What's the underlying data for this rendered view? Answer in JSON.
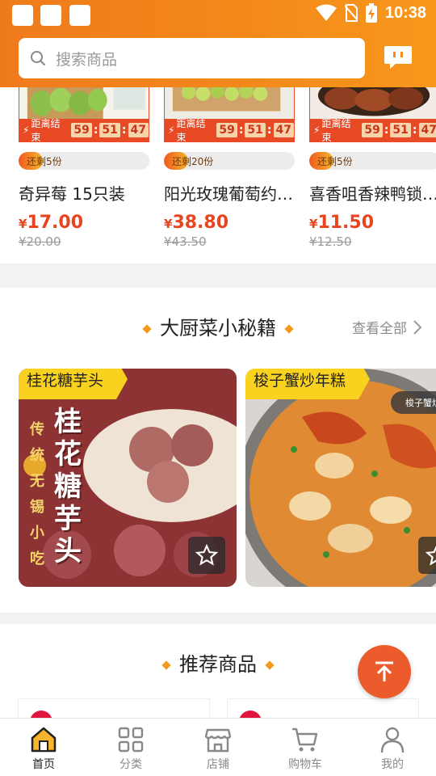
{
  "status": {
    "time": "10:38"
  },
  "search": {
    "placeholder": "搜索商品"
  },
  "flash_sale": {
    "countdown_label": "距离结束",
    "hours": "59",
    "minutes": "51",
    "seconds": "47",
    "items": [
      {
        "stock": "还剩5份",
        "name": "奇异莓 15只装",
        "currency": "¥",
        "price": "17.00",
        "old_price": "¥20.00"
      },
      {
        "stock": "还剩20份",
        "name": "阳光玫瑰葡萄约…",
        "currency": "¥",
        "price": "38.80",
        "old_price": "¥43.50"
      },
      {
        "stock": "还剩5份",
        "name": "喜香咀香辣鸭锁…",
        "currency": "¥",
        "price": "11.50",
        "old_price": "¥12.50"
      }
    ]
  },
  "recipes": {
    "title": "大厨菜小秘籍",
    "see_all": "查看全部",
    "items": [
      {
        "label": "桂花糖芋头",
        "overlay": "桂花糖芋头",
        "side_text": "传统无锡小吃"
      },
      {
        "label": "梭子蟹炒年糕",
        "pill": "梭子蟹炒"
      }
    ]
  },
  "recommend": {
    "title": "推荐商品"
  },
  "nav": {
    "items": [
      {
        "label": "首页",
        "icon": "home-icon",
        "active": true
      },
      {
        "label": "分类",
        "icon": "grid-icon"
      },
      {
        "label": "店铺",
        "icon": "store-icon"
      },
      {
        "label": "购物车",
        "icon": "cart-icon"
      },
      {
        "label": "我的",
        "icon": "user-icon"
      }
    ]
  },
  "colors": {
    "brand_orange": "#f48a1a",
    "price_red": "#e8441f",
    "label_yellow": "#f9d21f"
  }
}
